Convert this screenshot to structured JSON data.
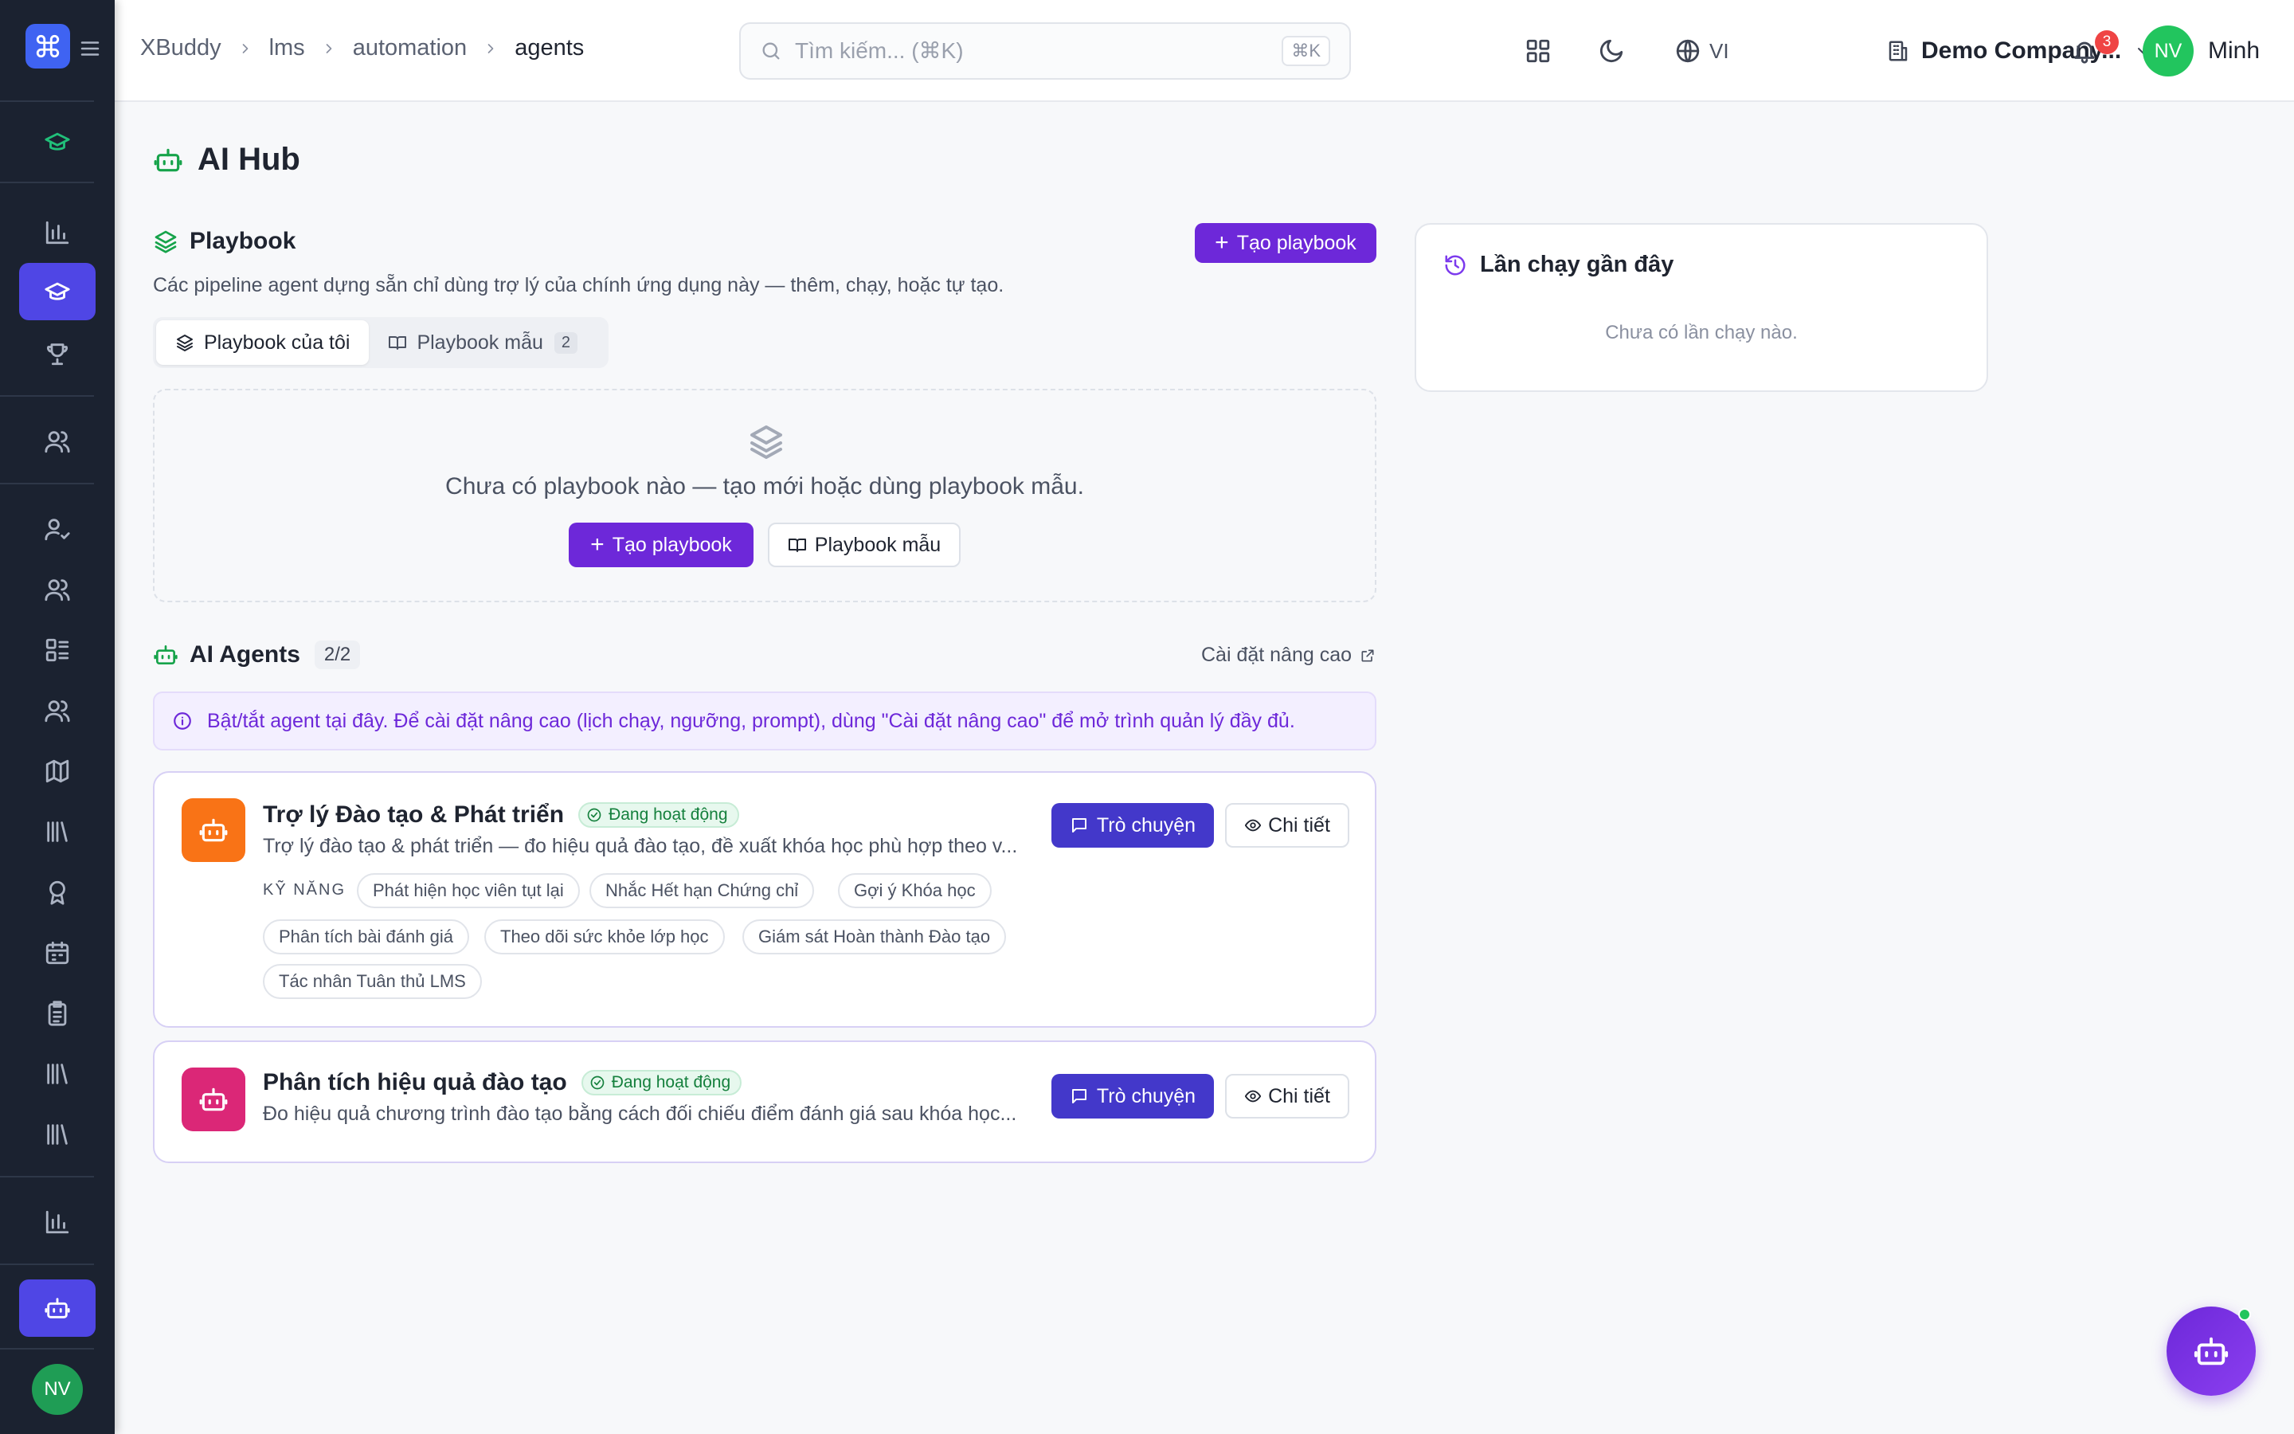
{
  "sidebar": {
    "avatar_initials": "NV",
    "items": [
      "graduation-cap",
      "bar-chart",
      "graduation-cap",
      "trophy",
      "users",
      "user-check",
      "users",
      "list",
      "users",
      "map",
      "library",
      "award",
      "calendar",
      "clipboard",
      "library",
      "library",
      "bar-chart",
      "bot"
    ]
  },
  "header": {
    "breadcrumbs": [
      "XBuddy",
      "lms",
      "automation",
      "agents"
    ],
    "search_placeholder": "Tìm kiếm... (⌘K)",
    "search_shortcut": "⌘K",
    "language": "VI",
    "company": "Demo Company...",
    "notifications": "3",
    "user_initials": "NV",
    "user_name": "Minh"
  },
  "page": {
    "title": "AI Hub"
  },
  "playbook": {
    "title": "Playbook",
    "create_label": "Tạo playbook",
    "description": "Các pipeline agent dựng sẵn chỉ dùng trợ lý của chính ứng dụng này — thêm, chạy, hoặc tự tạo.",
    "tabs": [
      {
        "label": "Playbook của tôi"
      },
      {
        "label": "Playbook mẫu",
        "count": "2"
      }
    ],
    "empty_text": "Chưa có playbook nào — tạo mới hoặc dùng playbook mẫu.",
    "empty_create_label": "Tạo playbook",
    "empty_template_label": "Playbook mẫu"
  },
  "agents": {
    "title": "AI Agents",
    "count": "2/2",
    "advanced_label": "Cài đặt nâng cao",
    "info": "Bật/tắt agent tại đây. Để cài đặt nâng cao (lịch chạy, ngưỡng, prompt), dùng \"Cài đặt nâng cao\" để mở trình quản lý đầy đủ.",
    "skills_label": "KỸ NĂNG",
    "chat_label": "Trò chuyện",
    "detail_label": "Chi tiết",
    "list": [
      {
        "name": "Trợ lý Đào tạo & Phát triển",
        "status": "Đang hoạt động",
        "description": "Trợ lý đào tạo & phát triển — đo hiệu quả đào tạo, đề xuất khóa học phù hợp theo v...",
        "icon_color": "#f97316",
        "skills": [
          "Phát hiện học viên tụt lại",
          "Nhắc Hết hạn Chứng chỉ",
          "Gợi ý Khóa học",
          "Phân tích bài đánh giá",
          "Theo dõi sức khỏe lớp học",
          "Giám sát Hoàn thành Đào tạo",
          "Tác nhân Tuân thủ LMS"
        ]
      },
      {
        "name": "Phân tích hiệu quả đào tạo",
        "status": "Đang hoạt động",
        "description": "Đo hiệu quả chương trình đào tạo bằng cách đối chiếu điểm đánh giá sau khóa học...",
        "icon_color": "#db2777",
        "skills": []
      }
    ]
  },
  "recent_runs": {
    "title": "Lần chạy gần đây",
    "empty": "Chưa có lần chạy nào."
  },
  "colors": {
    "primary": "#6d28d9",
    "chat_button": "#4338ca",
    "sidebar_bg": "#1b2230",
    "active_green": "#15803d"
  }
}
